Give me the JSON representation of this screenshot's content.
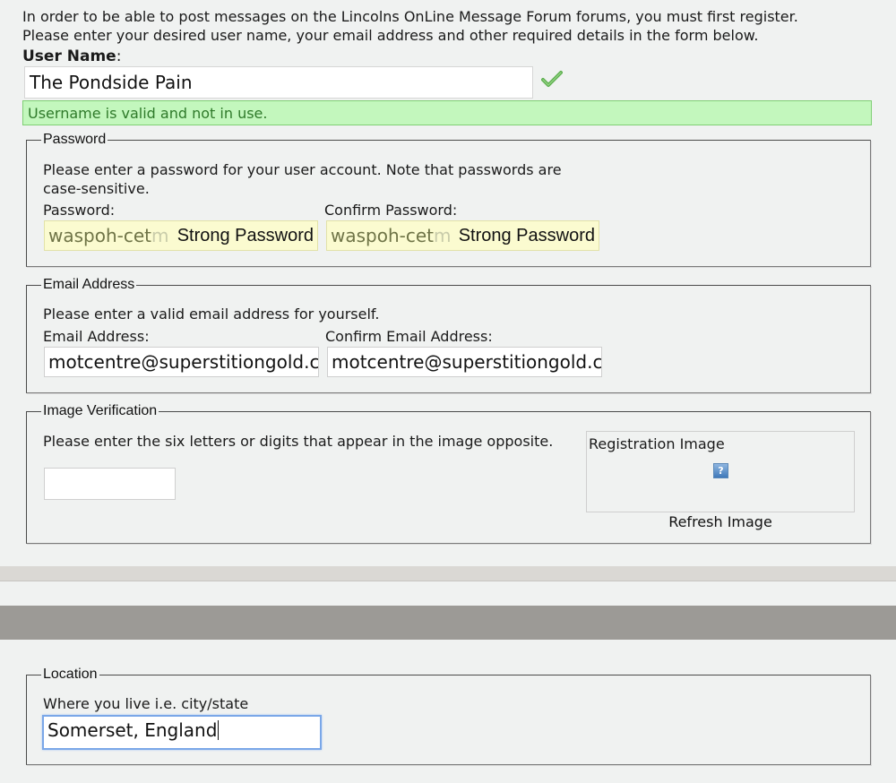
{
  "intro": {
    "line1": "In order to be able to post messages on the Lincolns OnLine Message Forum forums, you must first register.",
    "line2": "Please enter your desired user name, your email address and other required details in the form below."
  },
  "username": {
    "label": "User Name",
    "label_suffix": ":",
    "value": "The Pondside Pain",
    "status_icon": "checkmark-icon",
    "valid_message": "Username is valid and not in use."
  },
  "password_section": {
    "legend": "Password",
    "description_line1": "Please enter a password for your user account. Note that passwords are",
    "description_line2": "case-sensitive.",
    "password_label": "Password:",
    "confirm_label": "Confirm Password:",
    "password_value_visible": "waspoh-cet",
    "password_value_faded": "m",
    "confirm_value_visible": "waspoh-cet",
    "confirm_value_faded": "m",
    "strength_label": "Strong Password",
    "confirm_strength_label": "Strong Password"
  },
  "email_section": {
    "legend": "Email Address",
    "description": "Please enter a valid email address for yourself.",
    "email_label": "Email Address:",
    "confirm_label": "Confirm Email Address:",
    "email_value": "motcentre@superstitiongold.co.uk",
    "confirm_value": "motcentre@superstitiongold.co.uk"
  },
  "image_verification": {
    "legend": "Image Verification",
    "description": "Please enter the six letters or digits that appear in the image opposite.",
    "input_value": "",
    "image_label": "Registration Image",
    "broken_image_icon": "question-mark-icon",
    "refresh_label": "Refresh Image"
  },
  "location_section": {
    "legend": "Location",
    "description": "Where you live i.e. city/state",
    "value": "Somerset, England"
  },
  "colors": {
    "background": "#f0f2f1",
    "valid_bg": "#c3f7bd",
    "valid_text": "#2f7a2a",
    "password_field_bg": "#fbfbd0",
    "focus_border": "#7aa7e8"
  }
}
